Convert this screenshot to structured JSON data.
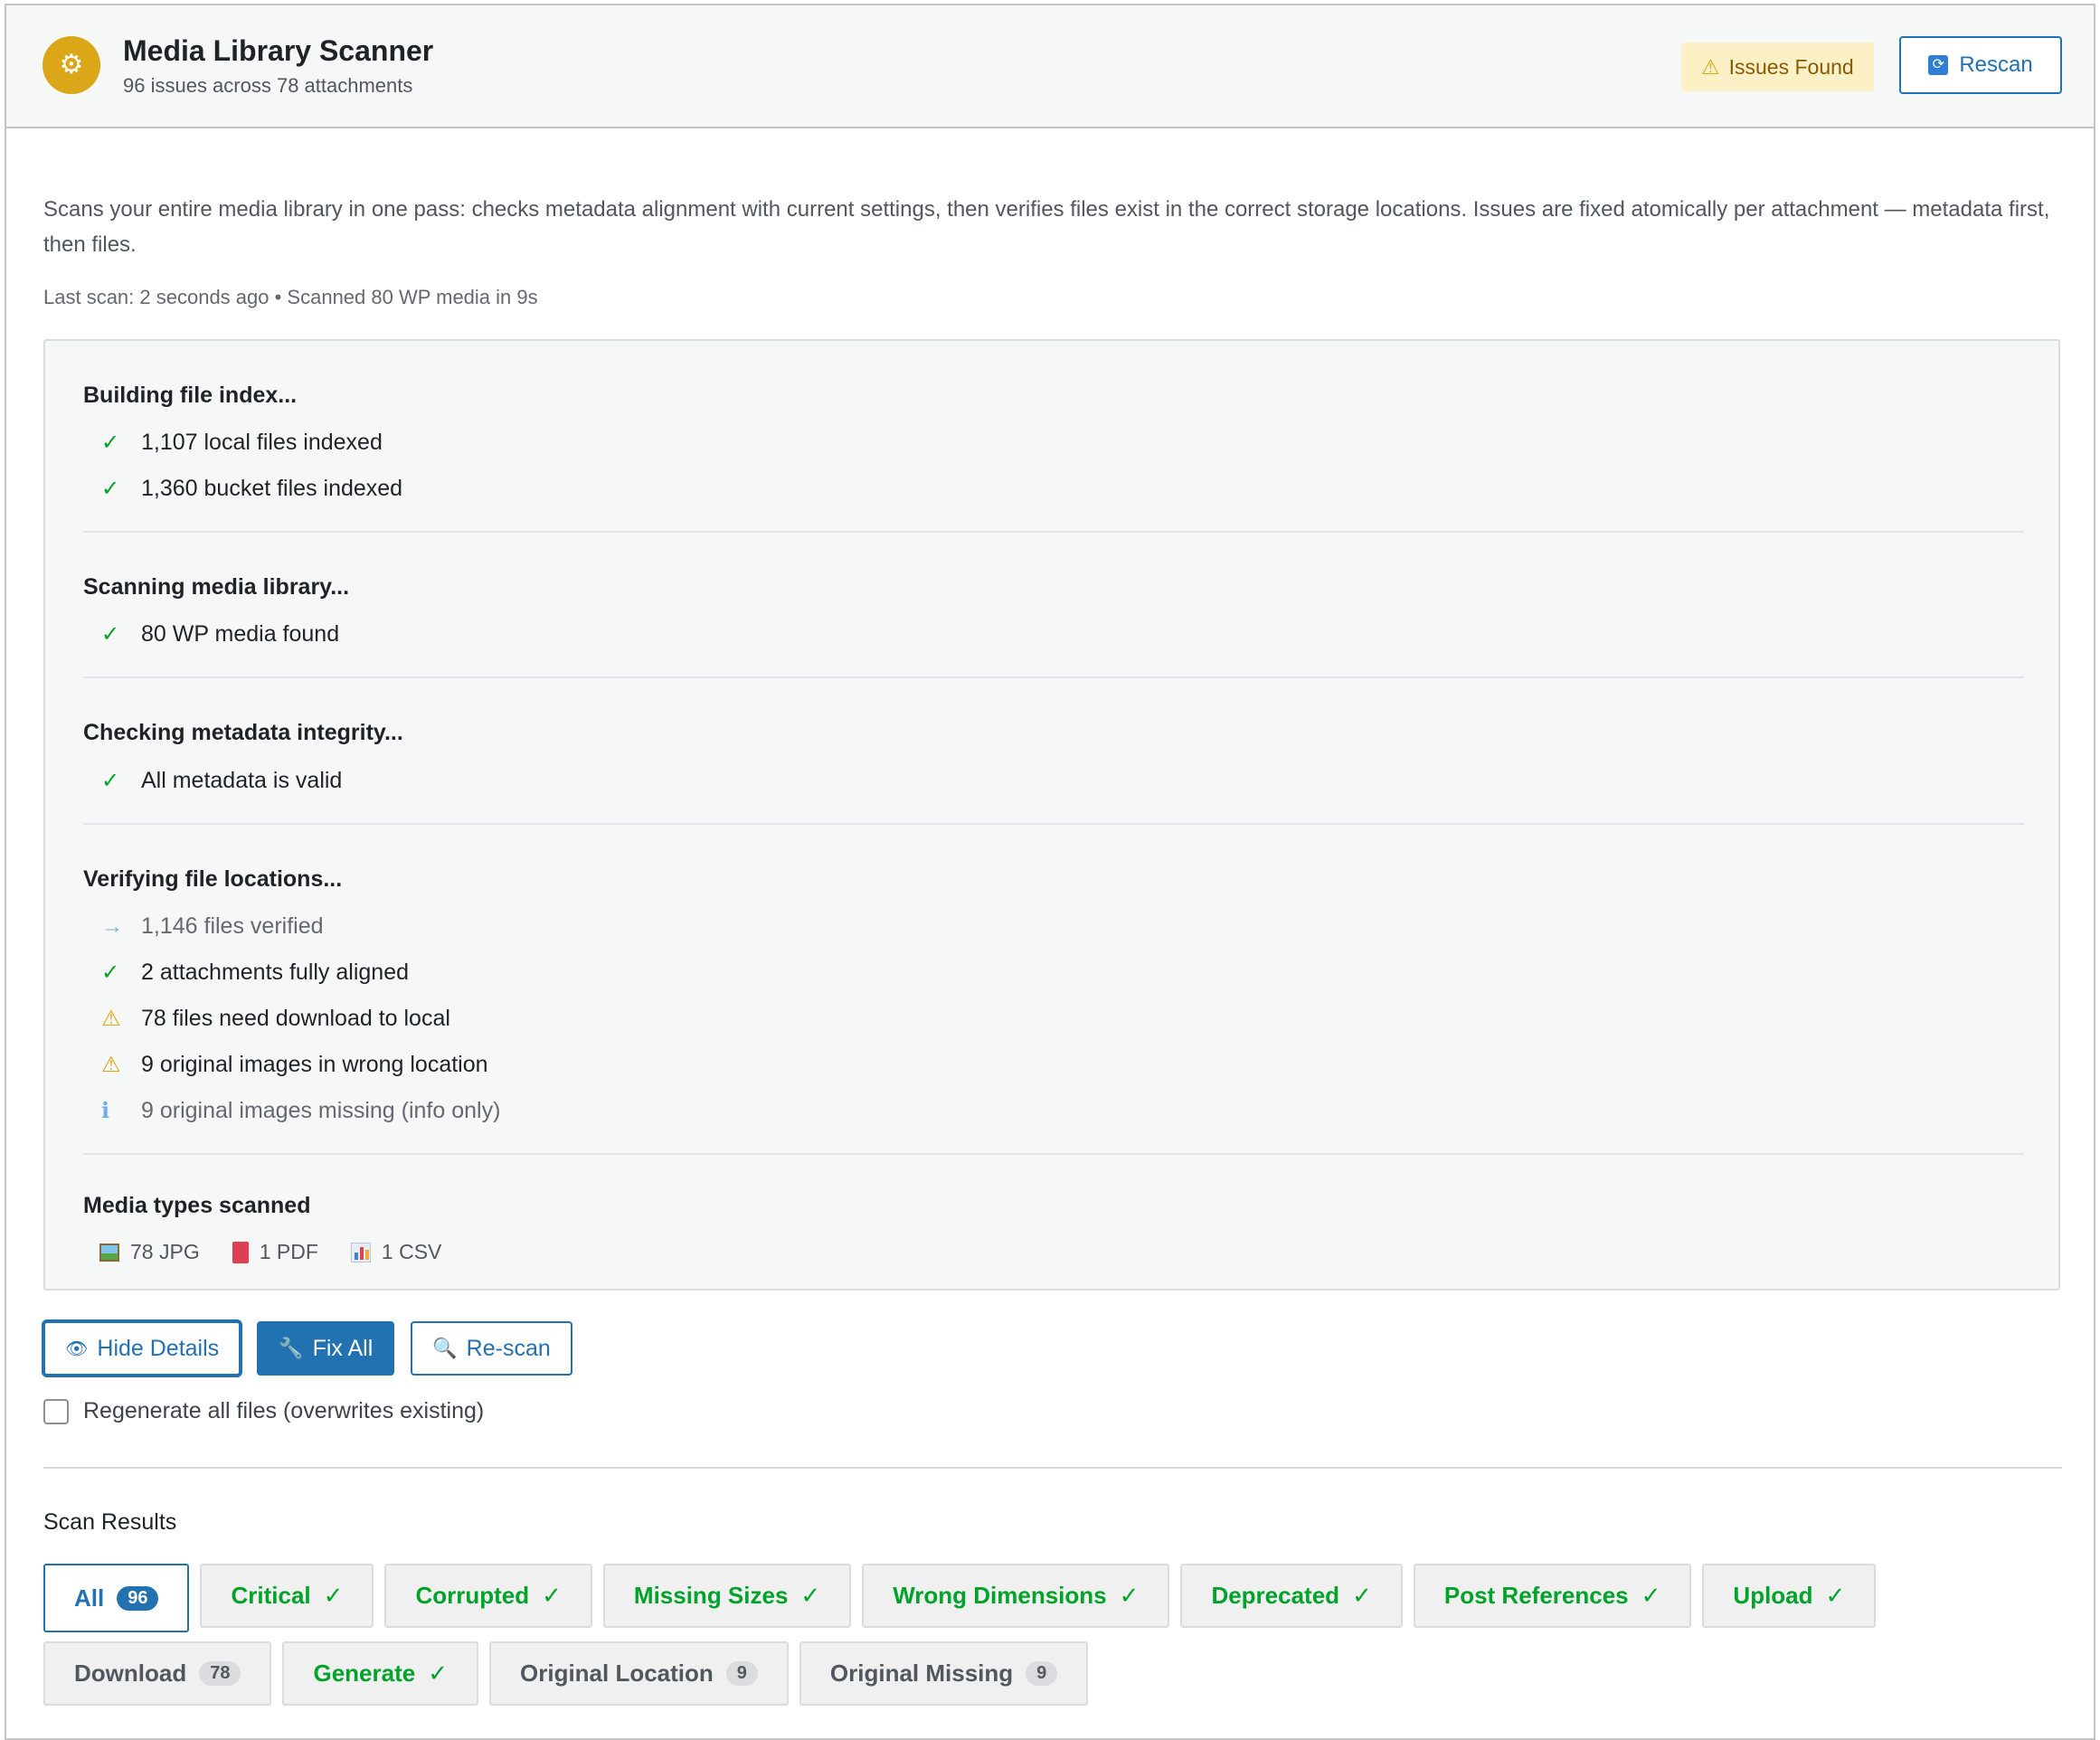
{
  "header": {
    "title": "Media Library Scanner",
    "subtitle": "96 issues across 78 attachments",
    "logo_icon": "gear-icon",
    "badge": "Issues Found",
    "badge_icon": "warning-icon",
    "rescan_label": "Rescan",
    "rescan_icon": "refresh-icon"
  },
  "description": "Scans your entire media library in one pass: checks metadata alignment with current settings, then verifies files exist in the correct storage locations. Issues are fixed atomically per attachment — metadata first, then files.",
  "last_scan": "Last scan: 2 seconds ago • Scanned 80 WP media in 9s",
  "progress": {
    "sections": [
      {
        "title": "Building file index...",
        "items": [
          {
            "status": "ok",
            "icon": "✓",
            "text": "1,107 local files indexed"
          },
          {
            "status": "ok",
            "icon": "✓",
            "text": "1,360 bucket files indexed"
          }
        ]
      },
      {
        "title": "Scanning media library...",
        "items": [
          {
            "status": "ok",
            "icon": "✓",
            "text": "80 WP media found"
          }
        ]
      },
      {
        "title": "Checking metadata integrity...",
        "items": [
          {
            "status": "ok",
            "icon": "✓",
            "text": "All metadata is valid"
          }
        ]
      },
      {
        "title": "Verifying file locations...",
        "items": [
          {
            "status": "info",
            "icon": "→",
            "text": "1,146 files verified"
          },
          {
            "status": "ok",
            "icon": "✓",
            "text": "2 attachments fully aligned"
          },
          {
            "status": "warn",
            "icon": "⚠",
            "text": "78 files need download to local"
          },
          {
            "status": "warn",
            "icon": "⚠",
            "text": "9 original images in wrong location"
          },
          {
            "status": "info",
            "icon": "ℹ",
            "text": "9 original images missing (info only)"
          }
        ]
      }
    ],
    "media_types_title": "Media types scanned",
    "media_types": [
      {
        "icon": "image-icon",
        "label": "78 JPG"
      },
      {
        "icon": "pdf-icon",
        "label": "1 PDF"
      },
      {
        "icon": "chart-icon",
        "label": "1 CSV"
      }
    ]
  },
  "actions": {
    "hide_details": "Hide Details",
    "fix_all": "Fix All",
    "rescan": "Re-scan",
    "regenerate_label": "Regenerate all files (overwrites existing)",
    "regenerate_checked": false
  },
  "results": {
    "title": "Scan Results",
    "tabs": [
      {
        "label": "All",
        "count": "96",
        "state": "active"
      },
      {
        "label": "Critical",
        "mark": "✓",
        "state": "green"
      },
      {
        "label": "Corrupted",
        "mark": "✓",
        "state": "green"
      },
      {
        "label": "Missing Sizes",
        "mark": "✓",
        "state": "green"
      },
      {
        "label": "Wrong Dimensions",
        "mark": "✓",
        "state": "green"
      },
      {
        "label": "Deprecated",
        "mark": "✓",
        "state": "green"
      },
      {
        "label": "Post References",
        "mark": "✓",
        "state": "green"
      },
      {
        "label": "Upload",
        "mark": "✓",
        "state": "green"
      },
      {
        "label": "Download",
        "count": "78",
        "state": "gray"
      },
      {
        "label": "Generate",
        "mark": "✓",
        "state": "green"
      },
      {
        "label": "Original Location",
        "count": "9",
        "state": "gray"
      },
      {
        "label": "Original Missing",
        "count": "9",
        "state": "gray"
      }
    ]
  },
  "colors": {
    "primary": "#2271b1",
    "success": "#00a32a",
    "warning": "#dba617",
    "info": "#72aee6"
  }
}
